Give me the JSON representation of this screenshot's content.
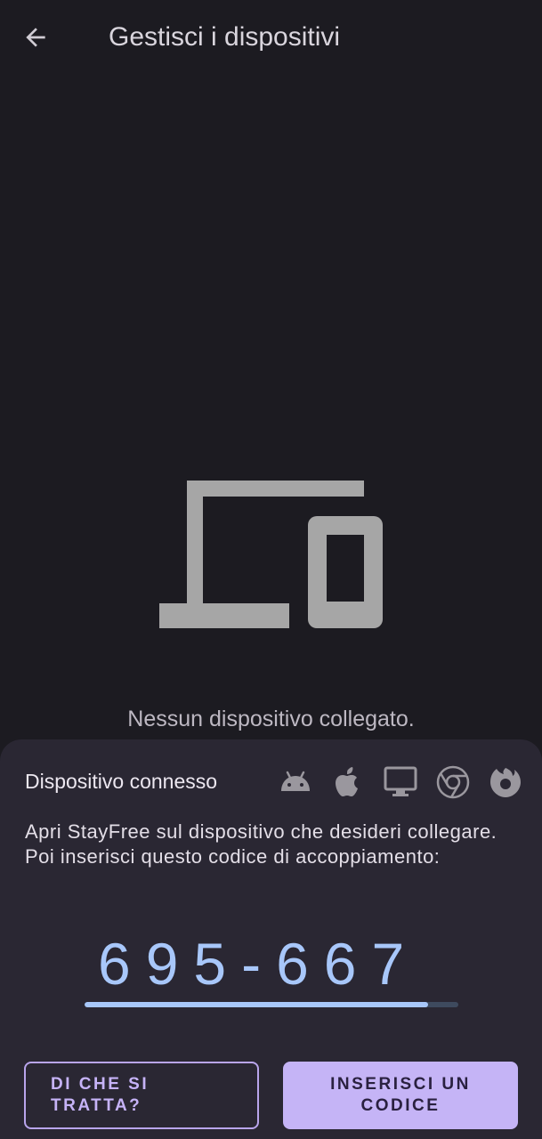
{
  "appbar": {
    "back_icon": "arrow-back-icon",
    "title": "Gestisci i dispositivi"
  },
  "empty_state": {
    "icon": "devices-icon",
    "message": "Nessun dispositivo collegato."
  },
  "sheet": {
    "title": "Dispositivo connesso",
    "platform_icons": [
      "android-icon",
      "apple-icon",
      "desktop-icon",
      "chrome-icon",
      "firefox-icon"
    ],
    "description": "Apri StayFree sul dispositivo che desideri collegare. Poi inserisci questo codice di accoppiamento:",
    "pairing_code": "695-667",
    "code_progress_percent": 92,
    "secondary_button": "DI CHE SI TRATTA?",
    "primary_button": "INSERISCI UN CODICE"
  },
  "colors": {
    "background": "#1c1b21",
    "sheet": "#2a2733",
    "accent": "#c5b4f6",
    "code": "#a8c7fa"
  }
}
